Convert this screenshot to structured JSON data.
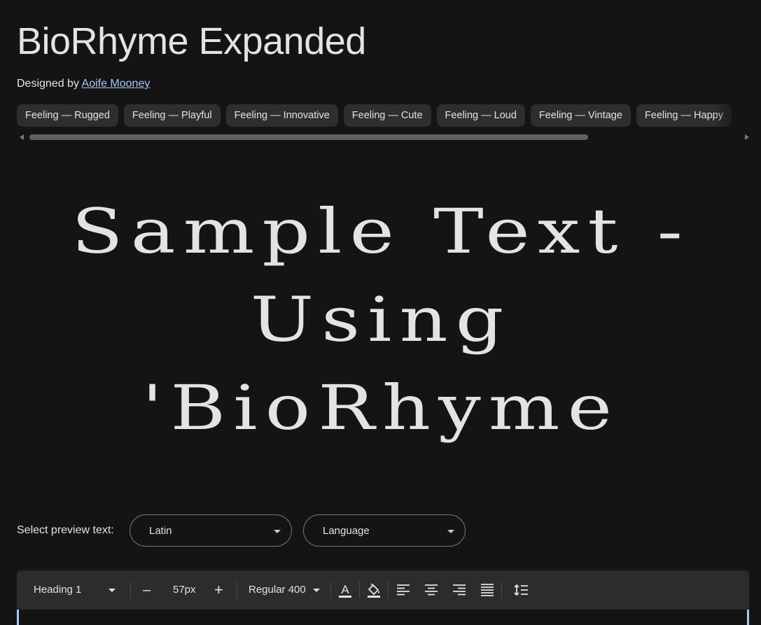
{
  "font": {
    "title": "BioRhyme Expanded",
    "designed_by_label": "Designed by",
    "designer": "Aoife Mooney"
  },
  "tags": [
    "Feeling — Rugged",
    "Feeling — Playful",
    "Feeling — Innovative",
    "Feeling — Cute",
    "Feeling — Loud",
    "Feeling — Vintage",
    "Feeling — Happy"
  ],
  "preview": {
    "line1": "Sample Text -",
    "line2": "Using",
    "line3": "'BioRhyme"
  },
  "select_preview": {
    "label": "Select preview text:",
    "script_value": "Latin",
    "language_value": "Language"
  },
  "toolbar": {
    "style_value": "Heading 1",
    "size_value": "57px",
    "decrease_label": "–",
    "increase_label": "+",
    "weight_value": "Regular 400"
  },
  "colors": {
    "background": "#141414",
    "text": "#e3e3e3",
    "link": "#a8c7fa",
    "chip_bg": "#2d2e2f",
    "toolbar_bg": "#2b2c2e"
  }
}
